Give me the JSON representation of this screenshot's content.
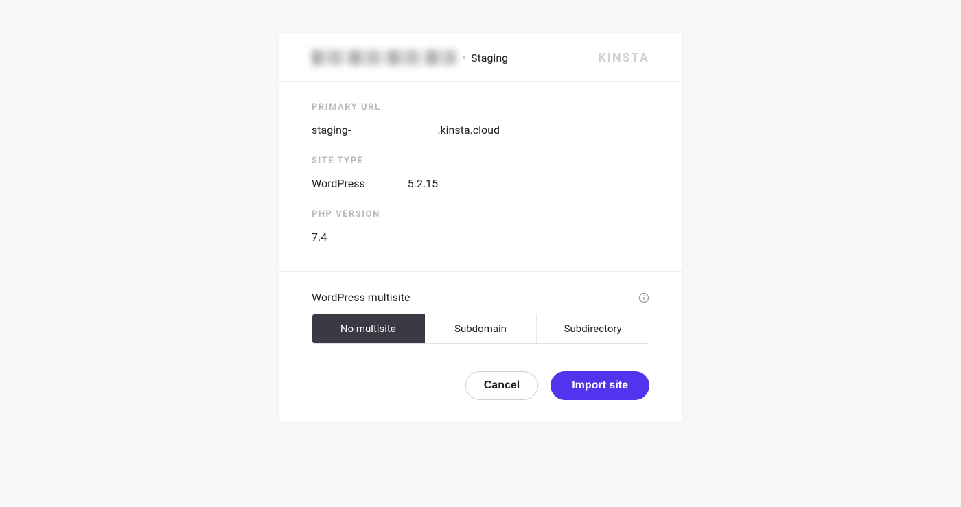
{
  "header": {
    "env_label": "Staging",
    "brand": "KINSTA"
  },
  "sections": {
    "primary_url": {
      "label": "PRIMARY URL",
      "prefix": "staging-",
      "suffix": ".kinsta.cloud"
    },
    "site_type": {
      "label": "SITE TYPE",
      "name": "WordPress",
      "version": "5.2.15"
    },
    "php_version": {
      "label": "PHP VERSION",
      "value": "7.4"
    }
  },
  "multisite": {
    "title": "WordPress multisite",
    "options": {
      "no_multisite": "No multisite",
      "subdomain": "Subdomain",
      "subdirectory": "Subdirectory"
    }
  },
  "actions": {
    "cancel": "Cancel",
    "import": "Import site"
  }
}
